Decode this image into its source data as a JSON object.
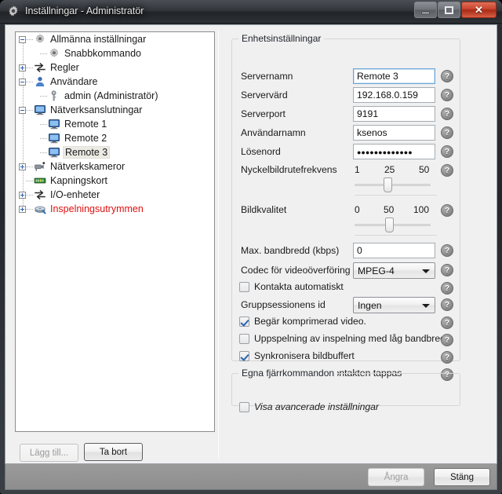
{
  "window": {
    "title": "Inställningar - Administratör",
    "icon": "gear-icon",
    "controls": {
      "minimize": "Minimera",
      "maximize": "Maximera",
      "close": "Stäng"
    }
  },
  "tree": {
    "items": [
      {
        "label": "Allmänna inställningar",
        "icon": "gear-icon",
        "indent": 0,
        "expander": "minus",
        "selected": false,
        "red": false
      },
      {
        "label": "Snabbkommando",
        "icon": "gear-icon",
        "indent": 1,
        "expander": "none",
        "selected": false,
        "red": false
      },
      {
        "label": "Regler",
        "icon": "arrows-icon",
        "indent": 0,
        "expander": "plus",
        "selected": false,
        "red": false
      },
      {
        "label": "Användare",
        "icon": "user-icon",
        "indent": 0,
        "expander": "minus",
        "selected": false,
        "red": false
      },
      {
        "label": "admin (Administratör)",
        "icon": "key-icon",
        "indent": 1,
        "expander": "none",
        "selected": false,
        "red": false
      },
      {
        "label": "Nätverksanslutningar",
        "icon": "monitor-icon",
        "indent": 0,
        "expander": "minus",
        "selected": false,
        "red": false
      },
      {
        "label": "Remote 1",
        "icon": "monitor-icon",
        "indent": 1,
        "expander": "none",
        "selected": false,
        "red": false
      },
      {
        "label": "Remote 2",
        "icon": "monitor-icon",
        "indent": 1,
        "expander": "none",
        "selected": false,
        "red": false
      },
      {
        "label": "Remote 3",
        "icon": "monitor-icon",
        "indent": 1,
        "expander": "none",
        "selected": true,
        "red": false
      },
      {
        "label": "Nätverkskameror",
        "icon": "camera-icon",
        "indent": 0,
        "expander": "plus",
        "selected": false,
        "red": false
      },
      {
        "label": "Kapningskort",
        "icon": "card-icon",
        "indent": 0,
        "expander": "none",
        "selected": false,
        "red": false
      },
      {
        "label": "I/O-enheter",
        "icon": "arrows-icon",
        "indent": 0,
        "expander": "plus",
        "selected": false,
        "red": false
      },
      {
        "label": "Inspelningsutrymmen",
        "icon": "disk-icon",
        "indent": 0,
        "expander": "plus",
        "selected": false,
        "red": true
      }
    ],
    "add_button": "Lägg till...",
    "remove_button": "Ta bort"
  },
  "device_settings": {
    "group_title": "Enhetsinställningar",
    "server_name_label": "Servernamn",
    "server_name_value": "Remote 3",
    "server_host_label": "Servervärd",
    "server_host_value": "192.168.0.159",
    "server_port_label": "Serverport",
    "server_port_value": "9191",
    "username_label": "Användarnamn",
    "username_value": "ksenos",
    "password_label": "Lösenord",
    "password_value": "●●●●●●●●●●●●●",
    "keyframe_label": "Nyckelbildrutefrekvens",
    "keyframe_ticks": [
      "1",
      "25",
      "50"
    ],
    "keyframe_value": 22,
    "keyframe_min": 1,
    "keyframe_max": 50,
    "quality_label": "Bildkvalitet",
    "quality_ticks": [
      "0",
      "50",
      "100"
    ],
    "quality_value": 45,
    "quality_min": 0,
    "quality_max": 100,
    "bandwidth_label": "Max. bandbredd (kbps)",
    "bandwidth_value": "0",
    "codec_label": "Codec för videoöverföring",
    "codec_value": "MPEG-4",
    "auto_contact_label": "Kontakta automatiskt",
    "auto_contact_checked": false,
    "group_session_label": "Gruppsessionens id",
    "group_session_value": "Ingen",
    "checkboxes": [
      {
        "label": "Begär komprimerad video.",
        "checked": true
      },
      {
        "label": "Uppspelning av inspelning med låg bandbredd.",
        "checked": false
      },
      {
        "label": "Synkronisera bildbuffert",
        "checked": true
      },
      {
        "label": "Felet uppstår när kontakten tappas",
        "checked": false
      }
    ],
    "help_glyph": "?"
  },
  "remote_commands": {
    "group_title": "Egna fjärrkommandon",
    "advanced_label": "Visa avancerade inställningar",
    "advanced_checked": false
  },
  "footer": {
    "undo_button": "Ångra",
    "close_button": "Stäng"
  },
  "colors": {
    "accent_red": "#e01010",
    "title_bg": "#2b2f33",
    "client_bg": "#f0f0f0",
    "close_button": "#c8432c",
    "check_blue": "#2a64b4"
  }
}
